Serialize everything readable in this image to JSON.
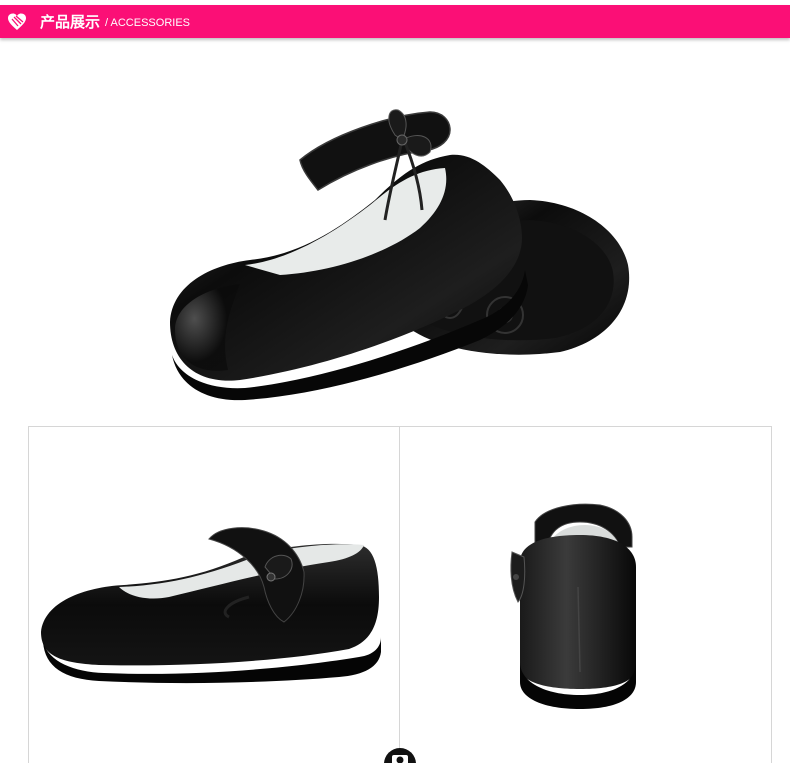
{
  "header": {
    "title": "产品展示",
    "subtitle": "/ ACCESSORIES",
    "bar_color": "#fb0f76",
    "logo_icon": "heart-logo-icon"
  },
  "images": {
    "hero": "black patent mary-jane shoe pair",
    "side_view": "shoe side view",
    "back_view": "shoe back view"
  },
  "footer": {
    "icon": "camera-icon"
  }
}
